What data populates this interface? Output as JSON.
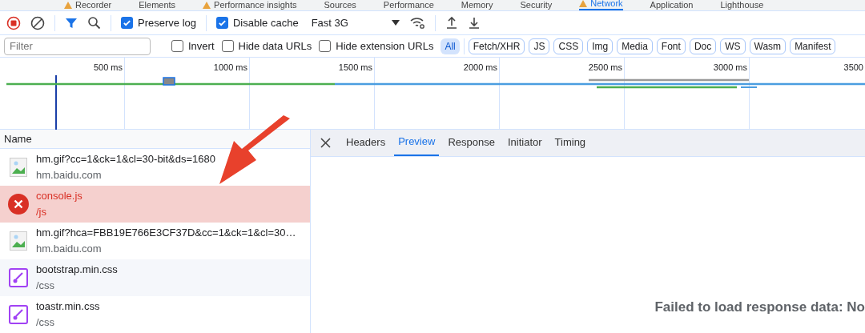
{
  "panel_tabs": [
    {
      "label": "Recorder",
      "warning": true,
      "selected": false
    },
    {
      "label": "Elements",
      "warning": false,
      "selected": false
    },
    {
      "label": "Performance insights",
      "warning": true,
      "selected": false
    },
    {
      "label": "Sources",
      "warning": false,
      "selected": false
    },
    {
      "label": "Performance",
      "warning": false,
      "selected": false
    },
    {
      "label": "Memory",
      "warning": false,
      "selected": false
    },
    {
      "label": "Security",
      "warning": false,
      "selected": false
    },
    {
      "label": "Network",
      "warning": true,
      "selected": true
    },
    {
      "label": "Application",
      "warning": false,
      "selected": false
    },
    {
      "label": "Lighthouse",
      "warning": false,
      "selected": false
    }
  ],
  "toolbar": {
    "preserve_log": {
      "label": "Preserve log",
      "checked": true
    },
    "disable_cache": {
      "label": "Disable cache",
      "checked": true
    },
    "throttling": "Fast 3G"
  },
  "filter_bar": {
    "placeholder": "Filter",
    "options": [
      {
        "label": "Invert",
        "checked": false
      },
      {
        "label": "Hide data URLs",
        "checked": false
      },
      {
        "label": "Hide extension URLs",
        "checked": false
      }
    ],
    "types": [
      {
        "label": "All",
        "selected": true
      },
      {
        "label": "Fetch/XHR",
        "selected": false
      },
      {
        "label": "JS",
        "selected": false
      },
      {
        "label": "CSS",
        "selected": false
      },
      {
        "label": "Img",
        "selected": false
      },
      {
        "label": "Media",
        "selected": false
      },
      {
        "label": "Font",
        "selected": false
      },
      {
        "label": "Doc",
        "selected": false
      },
      {
        "label": "WS",
        "selected": false
      },
      {
        "label": "Wasm",
        "selected": false
      },
      {
        "label": "Manifest",
        "selected": false
      }
    ]
  },
  "timeline": {
    "ticks": [
      "500 ms",
      "1000 ms",
      "1500 ms",
      "2000 ms",
      "2500 ms",
      "3000 ms",
      "3500"
    ]
  },
  "requests": {
    "column": "Name",
    "rows": [
      {
        "kind": "image",
        "name": "hm.gif?cc=1&ck=1&cl=30-bit&ds=1680",
        "path": "hm.baidu.com"
      },
      {
        "kind": "error",
        "name": "console.js",
        "path": "/js"
      },
      {
        "kind": "image",
        "name": "hm.gif?hca=FBB19E766E3CF37D&cc=1&ck=1&cl=30…",
        "path": "hm.baidu.com"
      },
      {
        "kind": "css",
        "name": "bootstrap.min.css",
        "path": "/css"
      },
      {
        "kind": "css",
        "name": "toastr.min.css",
        "path": "/css"
      }
    ]
  },
  "details": {
    "tabs": [
      {
        "label": "Headers",
        "selected": false
      },
      {
        "label": "Preview",
        "selected": true
      },
      {
        "label": "Response",
        "selected": false
      },
      {
        "label": "Initiator",
        "selected": false
      },
      {
        "label": "Timing",
        "selected": false
      }
    ],
    "message": "Failed to load response data: No"
  }
}
